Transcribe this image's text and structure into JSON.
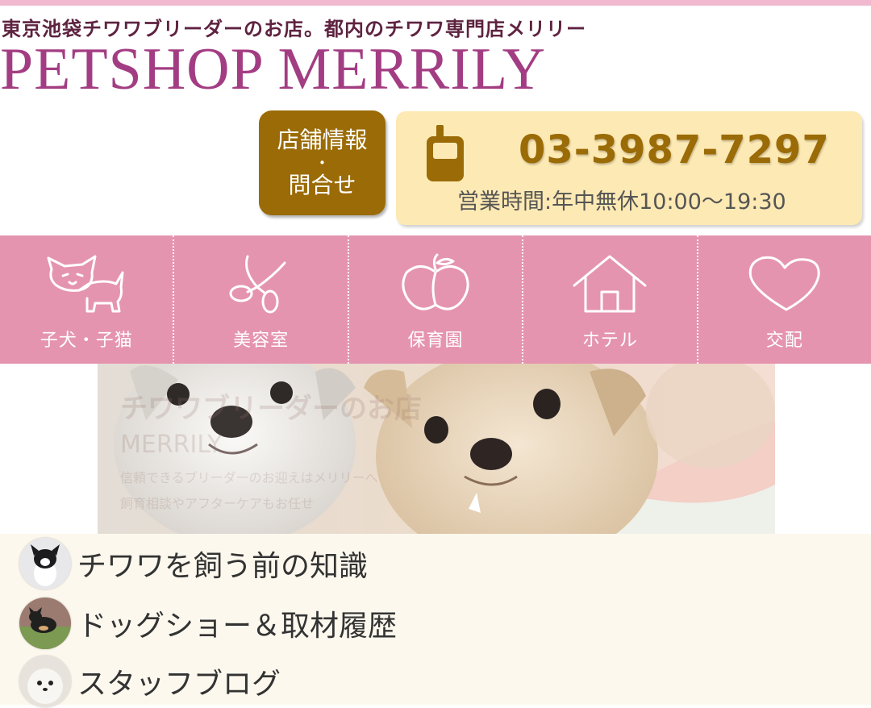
{
  "header": {
    "tagline": "東京池袋チワワブリーダーのお店。都内のチワワ専門店メリリー",
    "brand": "PETSHOP MERRILY"
  },
  "store_button": {
    "line1": "店舗情報",
    "dot": "・",
    "line2": "問合せ"
  },
  "contact": {
    "phone": "03-3987-7297",
    "hours": "営業時間:年中無休10:00〜19:30",
    "icon": "mobile-phone-icon"
  },
  "nav": {
    "items": [
      {
        "label": "子犬・子猫",
        "icon": "puppy-icon"
      },
      {
        "label": "美容室",
        "icon": "scissors-icon"
      },
      {
        "label": "保育園",
        "icon": "apple-icon"
      },
      {
        "label": "ホテル",
        "icon": "house-icon"
      },
      {
        "label": "交配",
        "icon": "heart-icon"
      }
    ]
  },
  "hero": {
    "overlay_title": "チワワブリーダーのお店",
    "overlay_subtitle": "MERRILY",
    "overlay_line1": "信頼できるブリーダーのお迎えはメリリーへ",
    "overlay_line2": "飼育相談やアフターケアもお任せ"
  },
  "links": [
    {
      "label": "チワワを飼う前の知識"
    },
    {
      "label": "ドッグショー＆取材履歴"
    },
    {
      "label": "スタッフブログ"
    }
  ],
  "colors": {
    "nav_pink": "#e594b0",
    "brand_purple": "#a33d83",
    "gold": "#9a6b06",
    "phone_bg": "#fde9b3",
    "list_bg": "#fcf8ee"
  }
}
